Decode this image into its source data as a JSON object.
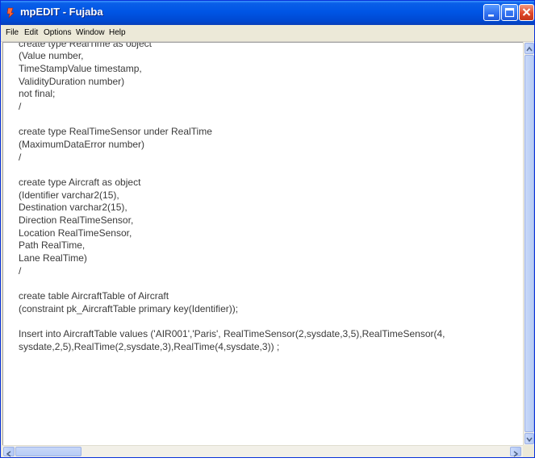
{
  "window": {
    "title": "mpEDIT - Fujaba",
    "title_color": "#ffffff",
    "titlebar_color": "#0055e5"
  },
  "menu": {
    "items": [
      "File",
      "Edit",
      "Options",
      "Window",
      "Help"
    ]
  },
  "editor": {
    "text_color": "#3a3a3a",
    "lines": [
      "create type RealTime as object",
      "(Value number,",
      "TimeStampValue timestamp,",
      "ValidityDuration number)",
      "not final;",
      "/",
      "",
      "create type RealTimeSensor under RealTime",
      "(MaximumDataError number)",
      "/",
      "",
      "create type Aircraft as object",
      "(Identifier varchar2(15),",
      "Destination varchar2(15),",
      "Direction RealTimeSensor,",
      "Location RealTimeSensor,",
      "Path RealTime,",
      "Lane RealTime)",
      "/",
      "",
      "create table AircraftTable of Aircraft",
      "(constraint pk_AircraftTable primary key(Identifier));",
      "",
      "Insert into AircraftTable values ('AIR001','Paris', RealTimeSensor(2,sysdate,3,5),RealTimeSensor(4,",
      "sysdate,2,5),RealTime(2,sysdate,3),RealTime(4,sysdate,3)) ;"
    ]
  }
}
